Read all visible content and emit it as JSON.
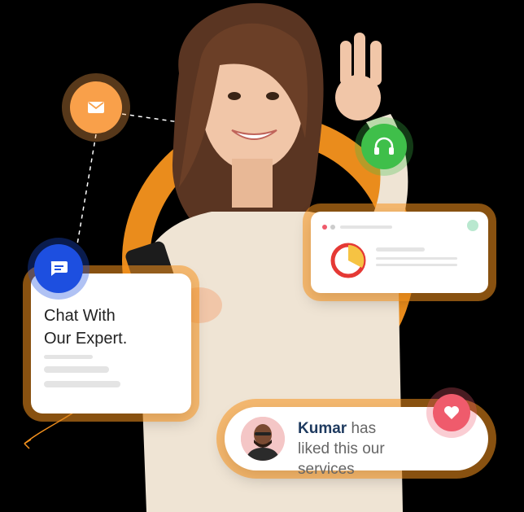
{
  "chat_card": {
    "title": "Chat With\nOur Expert."
  },
  "kumar_card": {
    "name": "Kumar",
    "message": " has liked this our services"
  },
  "icons": {
    "mail": "mail-icon",
    "headset": "headset-icon",
    "chat": "chat-icon",
    "heart": "heart-icon",
    "analytics": "pie-chart-icon"
  },
  "colors": {
    "accent": "#f7931e",
    "chat_blue": "#1d4fe0",
    "headset_green": "#3fbf4a",
    "heart_red": "#ef5b6c",
    "chart_red": "#e53935",
    "chart_yellow": "#f6c343"
  }
}
